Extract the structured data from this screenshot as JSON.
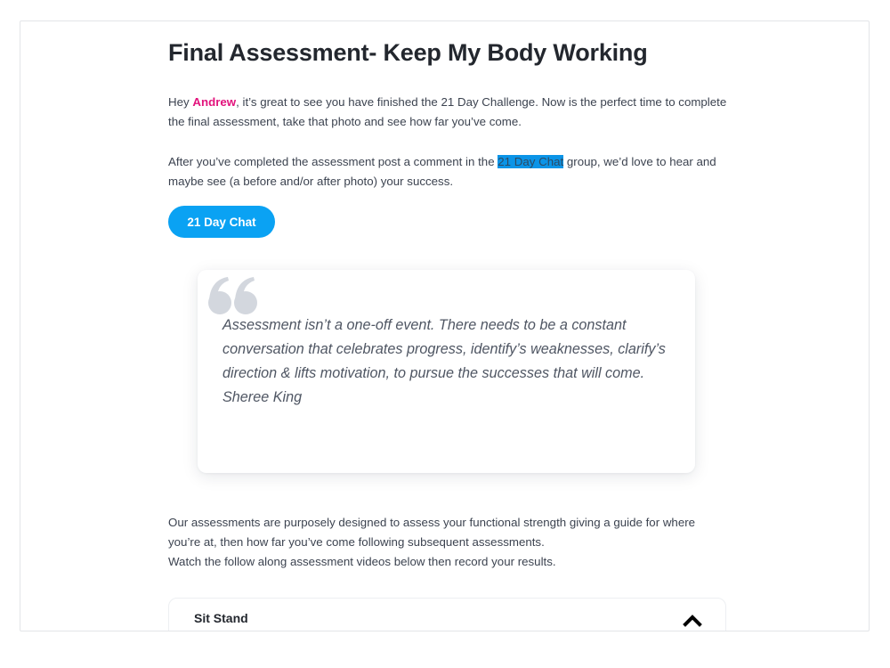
{
  "page": {
    "title": "Final Assessment- Keep My Body Working"
  },
  "intro": {
    "greeting": "Hey ",
    "user_name": "Andrew",
    "message": ", it’s great to see you have finished the 21 Day Challenge. Now is the perfect time to complete the final assessment, take that photo and see how far you’ve come."
  },
  "post_instructions": {
    "before": "After you’ve completed the assessment post a comment in the ",
    "highlight": "21 Day Chat",
    "after": " group, we’d love to hear and maybe see (a before and/or after photo) your success."
  },
  "chat_button": {
    "label": "21 Day Chat"
  },
  "quote": {
    "icon": "quote-marks-icon",
    "text": "Assessment isn’t a one-off event. There needs to be a constant conversation that celebrates progress, identify’s weaknesses, clarify’s direction & lifts motivation, to pursue the successes that will come.",
    "author": "Sheree King"
  },
  "assessment_info": {
    "line1": "Our assessments are purposely designed to assess your functional strength giving a guide for where you’re at, then how far you’ve come following subsequent assessments.",
    "line2": "Watch the follow along assessment videos below then record your results."
  },
  "accordion": {
    "items": [
      {
        "title": "Sit Stand",
        "state": "expanded",
        "toggle_icon": "chevron-up-icon"
      }
    ]
  },
  "colors": {
    "name_accent": "#e2137c",
    "button_bg": "#0aa2f3",
    "highlight_bg": "#0b94e7",
    "quote_icon": "#d3d7de",
    "heading": "#23272e",
    "body_text": "#3c4350"
  }
}
